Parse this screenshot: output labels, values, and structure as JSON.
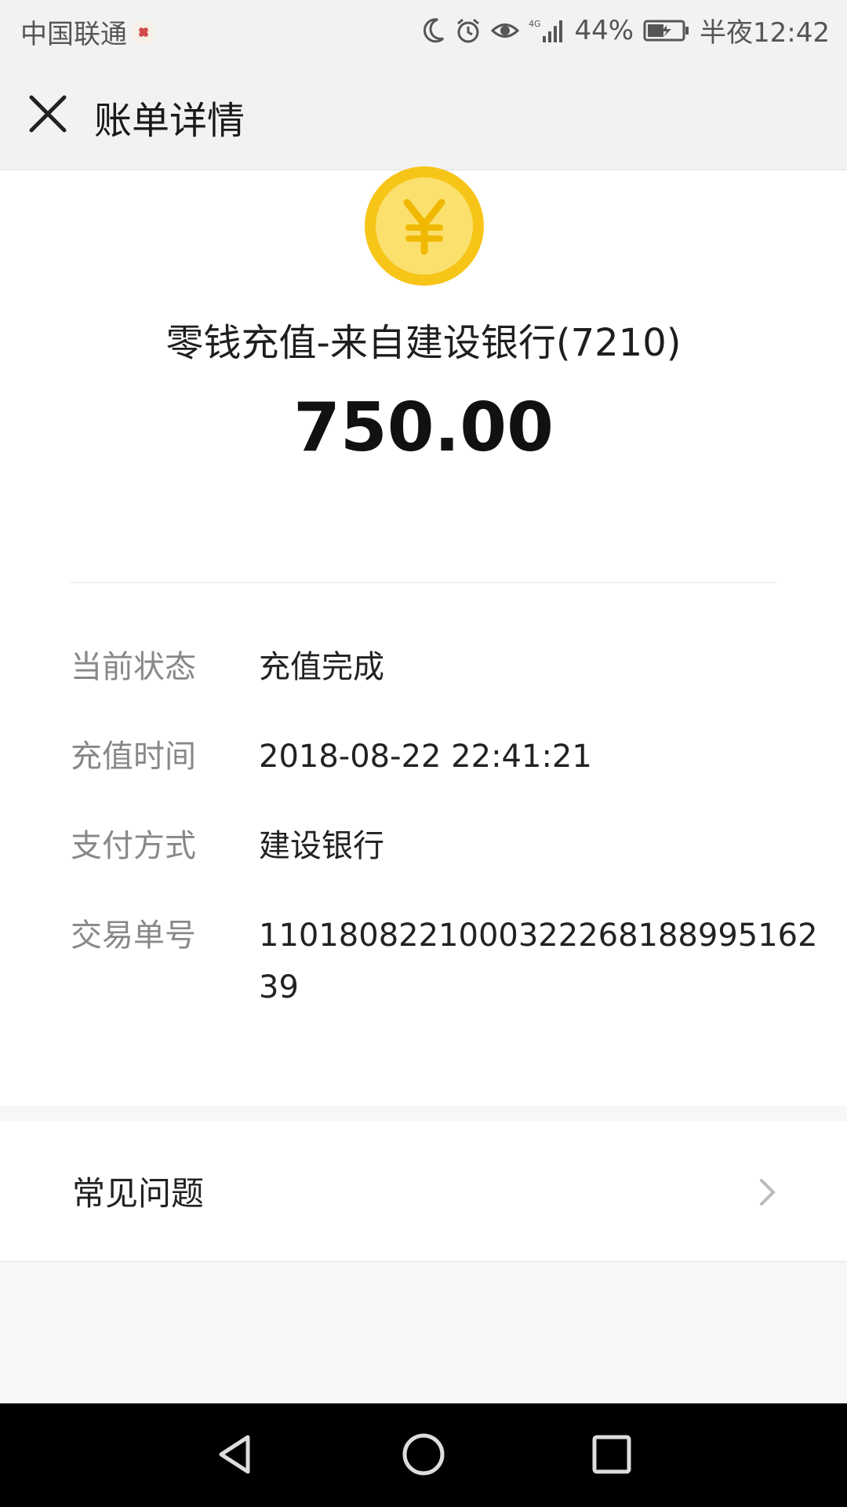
{
  "status_bar": {
    "carrier": "中国联通",
    "battery_percent": "44%",
    "time": "半夜12:42",
    "network": "4G",
    "icons": [
      "moon-icon",
      "alarm-icon",
      "eye-icon",
      "signal-icon",
      "battery-charging-icon"
    ]
  },
  "header": {
    "title": "账单详情",
    "close_icon": "close-icon"
  },
  "bill": {
    "coin_symbol": "¥",
    "title": "零钱充值-来自建设银行(7210)",
    "amount": "750.00"
  },
  "details": [
    {
      "label": "当前状态",
      "value": "充值完成"
    },
    {
      "label": "充值时间",
      "value": "2018-08-22 22:41:21"
    },
    {
      "label": "支付方式",
      "value": "建设银行"
    },
    {
      "label": "交易单号",
      "value": "110180822100032226818899516239"
    }
  ],
  "faq": {
    "label": "常见问题",
    "arrow_icon": "chevron-right-icon"
  },
  "nav": {
    "icons": [
      "back-icon",
      "home-icon",
      "recents-icon"
    ]
  },
  "colors": {
    "coin_outer": "#f7c518",
    "coin_inner": "#fbe06d",
    "coin_symbol": "#f0b800"
  }
}
